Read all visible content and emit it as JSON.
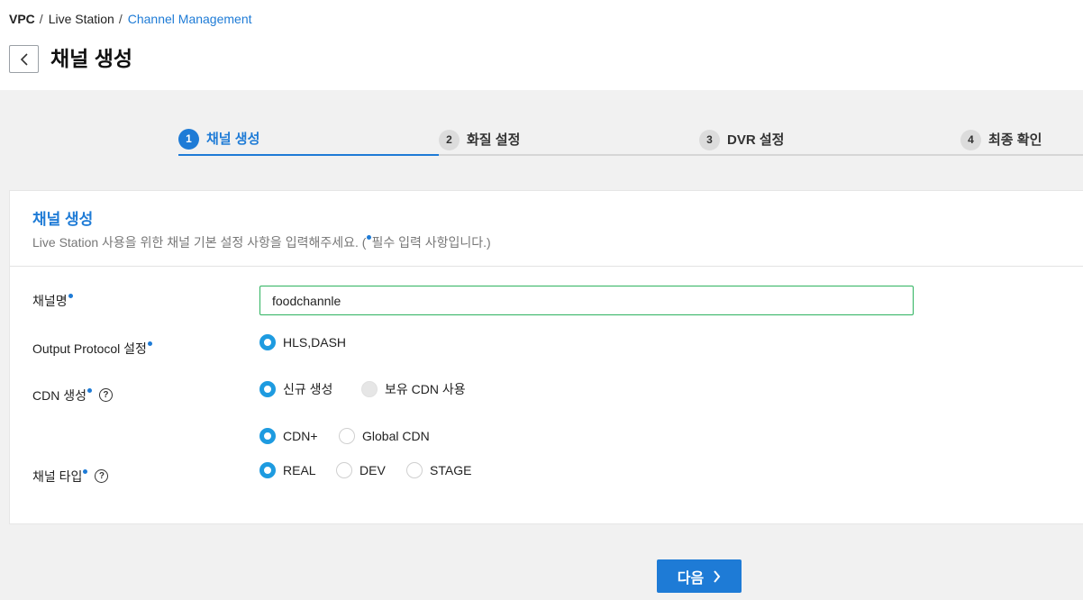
{
  "breadcrumb": {
    "item1": "VPC",
    "item2": "Live Station",
    "item3": "Channel Management",
    "separator": "/"
  },
  "page": {
    "title": "채널 생성"
  },
  "steps": [
    {
      "num": "1",
      "label": "채널 생성"
    },
    {
      "num": "2",
      "label": "화질 설정"
    },
    {
      "num": "3",
      "label": "DVR 설정"
    },
    {
      "num": "4",
      "label": "최종 확인"
    }
  ],
  "card": {
    "title": "채널 생성",
    "desc_before": "Live Station 사용을 위한 채널 기본 설정 사항을 입력해주세요. (",
    "desc_after": "필수 입력 사항입니다.)"
  },
  "form": {
    "channel_name_label": "채널명",
    "channel_name_value": "foodchannle",
    "output_protocol_label": "Output Protocol 설정",
    "output_protocol_option": "HLS,DASH",
    "cdn_label": "CDN 생성",
    "cdn_options": [
      "신규 생성",
      "보유 CDN 사용"
    ],
    "cdn_type_options": [
      "CDN+",
      "Global CDN"
    ],
    "channel_type_label": "채널 타입",
    "channel_type_options": [
      "REAL",
      "DEV",
      "STAGE"
    ],
    "help_symbol": "?"
  },
  "actions": {
    "next_label": "다음"
  },
  "colors": {
    "accent": "#1e7bd6",
    "radio": "#1e9be0",
    "input_border": "#2eb35f"
  }
}
